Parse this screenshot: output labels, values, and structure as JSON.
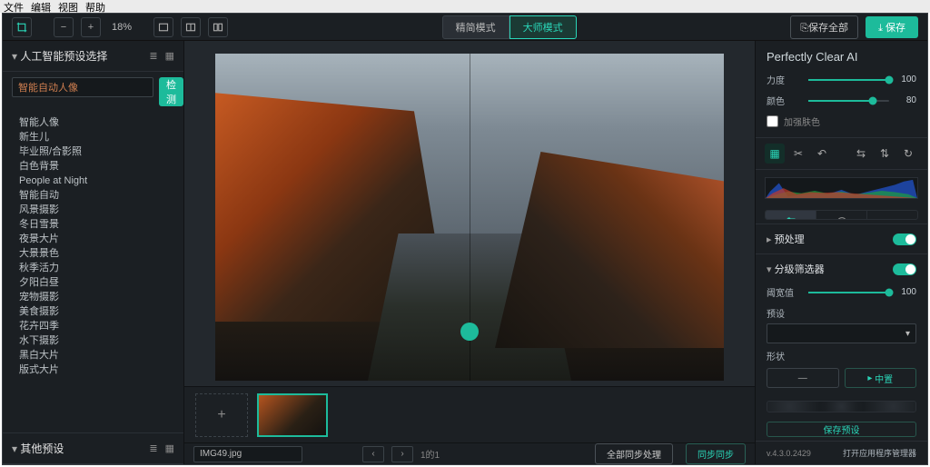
{
  "menubar": [
    "文件",
    "编辑",
    "视图",
    "帮助"
  ],
  "toolbar": {
    "zoom": "18%",
    "mode_simple": "精简模式",
    "mode_master": "大师模式",
    "save_all": "⎘保存全部",
    "save": "⤓ 保存"
  },
  "left": {
    "title": "人工智能预设选择",
    "select_value": "智能自动人像",
    "detect": "检测",
    "presets": [
      "智能人像",
      "新生儿",
      "毕业照/合影照",
      "白色背景",
      "People at Night",
      "智能自动",
      "风景摄影",
      "冬日雪景",
      "夜景大片",
      "大景景色",
      "秋季活力",
      "夕阳白昼",
      "宠物摄影",
      "美食摄影",
      "花卉四季",
      "水下摄影",
      "黑白大片",
      "版式大片"
    ],
    "other_title": "其他预设"
  },
  "bottom": {
    "filename": "IMG49.jpg",
    "counter": "1的1",
    "batch": "全部同步处理",
    "desync": "同步同步"
  },
  "right": {
    "brand": "Perfectly Clear AI",
    "sliders": {
      "strength_label": "力度",
      "strength_val": "100",
      "hue_label": "颜色",
      "hue_val": "80",
      "skin_label": "加强肤色"
    },
    "sections": {
      "pre": "预处理",
      "classifier": "分级筛选器",
      "threshold_label": "阈宽值",
      "threshold_val": "100",
      "preset_label": "预设",
      "shape_label": "形状",
      "center": "中置",
      "save_preset": "保存预设"
    },
    "version": "v.4.3.0.2429",
    "open_mgr": "打开应用程序管理器"
  }
}
